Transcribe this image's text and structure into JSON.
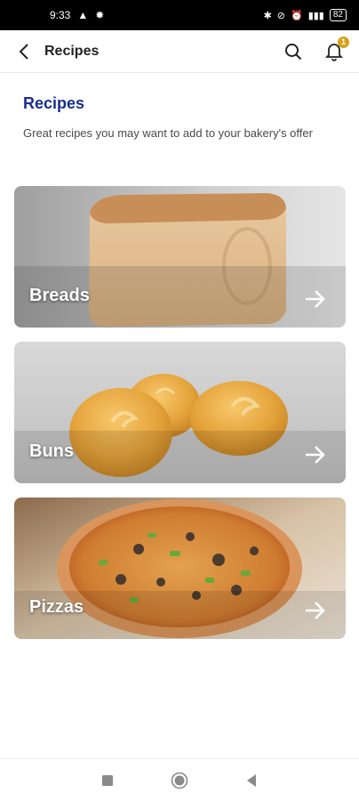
{
  "status_bar": {
    "time": "9:33",
    "battery": "82"
  },
  "app_bar": {
    "title": "Recipes",
    "notification_count": "1"
  },
  "page": {
    "title": "Recipes",
    "subtitle": "Great recipes you may want to add to your bakery's offer"
  },
  "cards": [
    {
      "label": "Breads",
      "icon": "arrow-right-icon"
    },
    {
      "label": "Buns",
      "icon": "arrow-right-icon"
    },
    {
      "label": "Pizzas",
      "icon": "arrow-right-icon"
    }
  ],
  "colors": {
    "title": "#1a2e8f",
    "badge": "#d4a31b"
  }
}
